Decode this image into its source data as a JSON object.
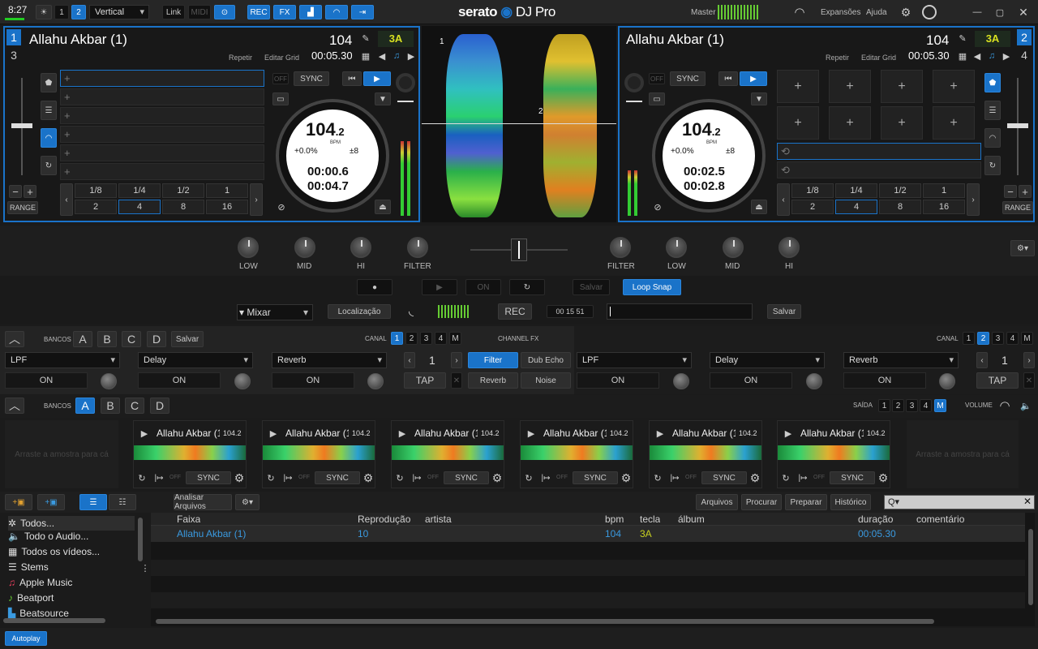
{
  "topbar": {
    "time": "8:27",
    "deck_modes": [
      "1",
      "2"
    ],
    "layout": "Vertical",
    "link": "Link",
    "midi": "MIDI",
    "buttons": [
      "REC",
      "FX"
    ],
    "brand": "serato",
    "product": "DJ Pro",
    "master": "Master",
    "expansions": "Expansões",
    "help": "Ajuda"
  },
  "deck_left": {
    "num_top": "1",
    "num_bottom": "3",
    "title": "Allahu Akbar (1)",
    "bpm": "104",
    "key": "3A",
    "repeat": "Repetir",
    "edit_grid": "Editar Grid",
    "time": "00:05.30",
    "off": "OFF",
    "sync": "SYNC",
    "bpm_big": "104",
    "bpm_dec": ".2",
    "bpm_label": "BPM",
    "pitch": "+0.0%",
    "range": "±8",
    "elapsed": "00:00.6",
    "remain": "00:04.7",
    "range_btn": "RANGE",
    "loops_top": [
      "1/8",
      "1/4",
      "1/2",
      "1"
    ],
    "loops_bottom": [
      "2",
      "4",
      "8",
      "16"
    ]
  },
  "deck_right": {
    "num_top": "2",
    "num_bottom": "4",
    "title": "Allahu Akbar (1)",
    "bpm": "104",
    "key": "3A",
    "repeat": "Repetir",
    "edit_grid": "Editar Grid",
    "time": "00:05.30",
    "off": "OFF",
    "sync": "SYNC",
    "bpm_big": "104",
    "bpm_dec": ".2",
    "bpm_label": "BPM",
    "pitch": "+0.0%",
    "range": "±8",
    "elapsed": "00:02.5",
    "remain": "00:02.8",
    "range_btn": "RANGE",
    "loops_top": [
      "1/8",
      "1/4",
      "1/2",
      "1"
    ],
    "loops_bottom": [
      "2",
      "4",
      "8",
      "16"
    ]
  },
  "waveform_markers": [
    "1",
    "2"
  ],
  "mixer": {
    "left": [
      "LOW",
      "MID",
      "HI",
      "FILTER"
    ],
    "right": [
      "FILTER",
      "LOW",
      "MID",
      "HI"
    ]
  },
  "transport": {
    "on": "ON",
    "save": "Salvar",
    "loop_snap": "Loop Snap",
    "mix_select": "Mixar",
    "location": "Localização",
    "rec": "REC",
    "rec_time": "00 15 51",
    "save2": "Salvar"
  },
  "fx": {
    "banks": "BANCOS",
    "bank_labels": [
      "A",
      "B",
      "C",
      "D"
    ],
    "save": "Salvar",
    "canal": "CANAL",
    "channels": [
      "1",
      "2",
      "3",
      "4",
      "M"
    ],
    "channel_fx": "CHANNEL FX",
    "left_effects": [
      "LPF",
      "Delay",
      "Reverb"
    ],
    "right_effects": [
      "LPF",
      "Delay",
      "Reverb"
    ],
    "on": "ON",
    "beats": "1",
    "tap": "TAP",
    "cfx": [
      "Filter",
      "Dub Echo",
      "Reverb",
      "Noise"
    ]
  },
  "sampler": {
    "banks": "BANCOS",
    "bank_labels": [
      "A",
      "B",
      "C",
      "D"
    ],
    "output": "SAÍDA",
    "outputs": [
      "1",
      "2",
      "3",
      "4",
      "M"
    ],
    "volume": "VOLUME",
    "drop_hint": "Arraste a amostra para cá",
    "slots": [
      {
        "title": "Allahu Akbar (1",
        "bpm": "104.2",
        "sync": "SYNC",
        "off": "OFF"
      },
      {
        "title": "Allahu Akbar (1",
        "bpm": "104.2",
        "sync": "SYNC",
        "off": "OFF"
      },
      {
        "title": "Allahu Akbar (1",
        "bpm": "104.2",
        "sync": "SYNC",
        "off": "OFF"
      },
      {
        "title": "Allahu Akbar (1",
        "bpm": "104.2",
        "sync": "SYNC",
        "off": "OFF"
      },
      {
        "title": "Allahu Akbar (1",
        "bpm": "104.2",
        "sync": "SYNC",
        "off": "OFF"
      },
      {
        "title": "Allahu Akbar (1",
        "bpm": "104.2",
        "sync": "SYNC",
        "off": "OFF"
      }
    ]
  },
  "library": {
    "analyze": "Analisar Arquivos",
    "tabs": [
      "Arquivos",
      "Procurar",
      "Preparar",
      "Histórico"
    ],
    "search_placeholder": "Q▾",
    "columns": [
      "Faixa",
      "Reprodução",
      "artista",
      "bpm",
      "tecla",
      "álbum",
      "duração",
      "comentário"
    ],
    "row": {
      "track": "Allahu Akbar (1)",
      "plays": "10",
      "artist": "",
      "bpm": "104",
      "key": "3A",
      "album": "",
      "duration": "00:05.30",
      "comment": ""
    },
    "sidebar": [
      "Todos...",
      "Todo o Audio...",
      "Todos os vídeos...",
      "Stems",
      "Apple Music",
      "Beatport",
      "Beatsource"
    ],
    "autoplay": "Autoplay"
  }
}
